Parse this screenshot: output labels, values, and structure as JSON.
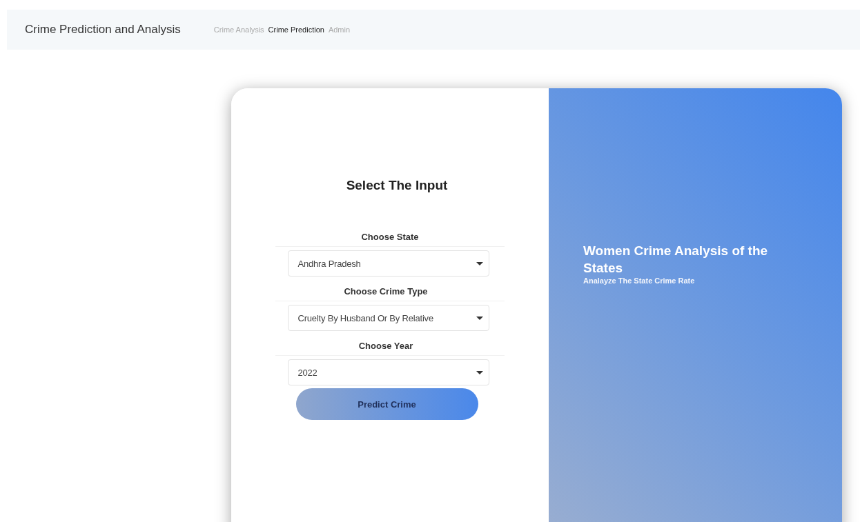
{
  "navbar": {
    "brand": "Crime Prediction and Analysis",
    "links": [
      {
        "label": "Crime Analysis",
        "selected": false
      },
      {
        "label": "Crime Prediction",
        "selected": true
      },
      {
        "label": "Admin",
        "selected": false
      }
    ]
  },
  "form": {
    "title": "Select The Input",
    "fields": [
      {
        "label": "Choose State",
        "value": "Andhra Pradesh"
      },
      {
        "label": "Choose Crime Type",
        "value": "Cruelty By Husband Or By Relative"
      },
      {
        "label": "Choose Year",
        "value": "2022"
      }
    ],
    "button": "Predict Crime"
  },
  "panel": {
    "title": "Women Crime Analysis of the States",
    "subtitle": "Analayze The State Crime Rate"
  }
}
